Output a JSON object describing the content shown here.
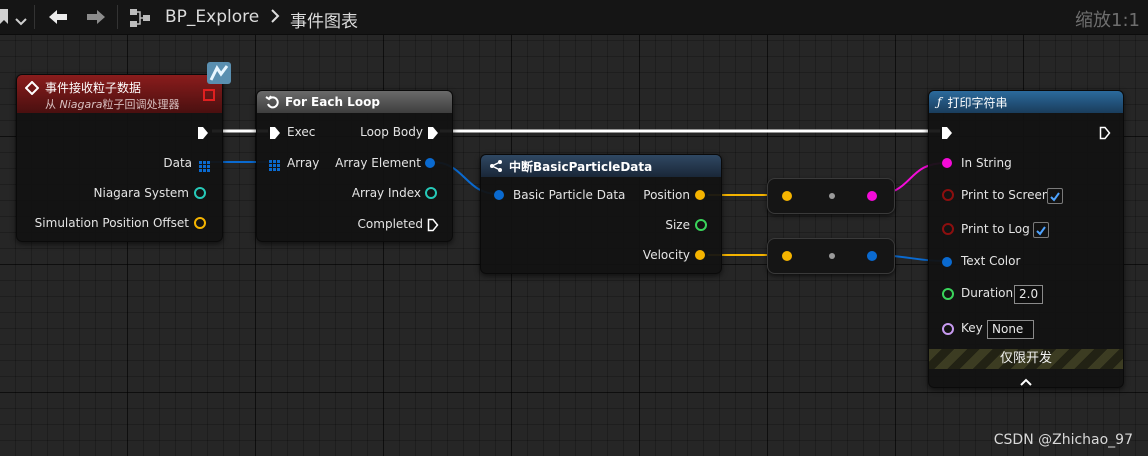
{
  "toolbar": {
    "breadcrumb_root": "BP_Explore",
    "breadcrumb_current": "事件图表",
    "zoom_label": "缩放1:1"
  },
  "nodes": {
    "event": {
      "title": "事件接收粒子数据",
      "subtitle_prefix": "从 ",
      "subtitle_italic": "Niagara",
      "subtitle_suffix": "粒子回调处理器",
      "pins": [
        "Data",
        "Niagara System",
        "Simulation Position Offset"
      ]
    },
    "foreach": {
      "title": "For Each Loop",
      "in_pins": [
        "Exec",
        "Array"
      ],
      "out_pins": [
        "Loop Body",
        "Array Element",
        "Array Index",
        "Completed"
      ]
    },
    "breakdata": {
      "title": "中断BasicParticleData",
      "in_pins": [
        "Basic Particle Data"
      ],
      "out_pins": [
        "Position",
        "Size",
        "Velocity"
      ]
    },
    "printstring": {
      "title": "打印字符串",
      "pins": [
        "In String",
        "Print to Screen",
        "Print to Log",
        "Text Color",
        "Duration",
        "Key"
      ],
      "duration_value": "2.0",
      "key_value": "None",
      "print_to_screen_checked": true,
      "print_to_log_checked": true,
      "dev_only_label": "仅限开发"
    }
  },
  "colors": {
    "exec": "#ffffff",
    "struct_blue": "#0a6ad0",
    "vector_yellow": "#f5b400",
    "string_magenta": "#f40bd8",
    "float_green": "#3ad45b",
    "niagara_teal": "#26c9b8",
    "name_purple": "#c79af0",
    "bool_red": "#8c0f0f",
    "event_header": "#8a1c1c",
    "foreach_header": "#606060",
    "break_header": "#283a50",
    "print_header": "#1f4f78"
  },
  "watermark": "CSDN @Zhichao_97"
}
